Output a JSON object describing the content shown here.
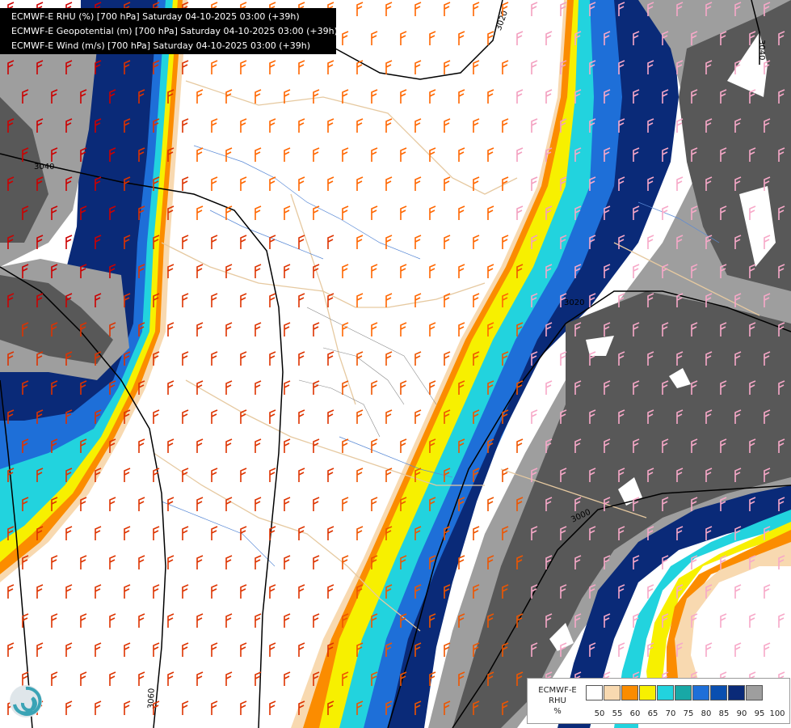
{
  "header": {
    "lines": [
      "ECMWF-E RHU (%) [700 hPa] Saturday 04-10-2025 03:00 (+39h)",
      "ECMWF-E Geopotential (m) [700 hPa] Saturday 04-10-2025 03:00 (+39h)",
      "ECMWF-E Wind (m/s) [700 hPa] Saturday 04-10-2025 03:00 (+39h)"
    ]
  },
  "contours": {
    "labels": [
      "3040",
      "3020",
      "3020",
      "3000",
      "3060",
      "3040"
    ]
  },
  "legend": {
    "title_lines": [
      "ECMWF-E",
      "RHU",
      "%"
    ],
    "ticks": [
      "50",
      "55",
      "60",
      "65",
      "70",
      "75",
      "80",
      "85",
      "90",
      "95",
      "100"
    ],
    "colors": [
      "#ffffff",
      "#f8d9b0",
      "#fb8c00",
      "#f7f000",
      "#22d3de",
      "#18a8a6",
      "#1e6fd8",
      "#0a4fb0",
      "#0a2a78",
      "#9e9e9e",
      "#585858"
    ]
  },
  "icons": {
    "logo": "ecmwf-swirl-logo"
  }
}
